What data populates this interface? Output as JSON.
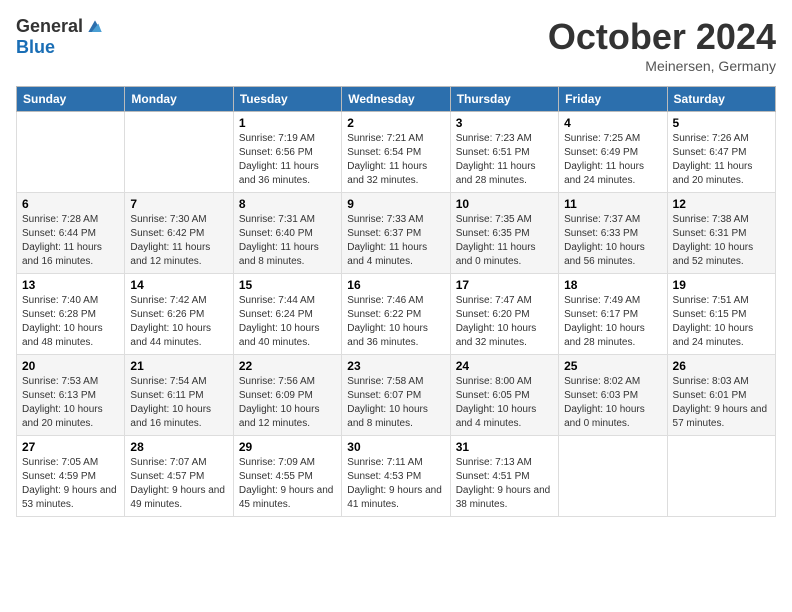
{
  "header": {
    "logo_general": "General",
    "logo_blue": "Blue",
    "month_title": "October 2024",
    "location": "Meinersen, Germany"
  },
  "days_of_week": [
    "Sunday",
    "Monday",
    "Tuesday",
    "Wednesday",
    "Thursday",
    "Friday",
    "Saturday"
  ],
  "weeks": [
    [
      {
        "day": "",
        "info": ""
      },
      {
        "day": "",
        "info": ""
      },
      {
        "day": "1",
        "info": "Sunrise: 7:19 AM\nSunset: 6:56 PM\nDaylight: 11 hours and 36 minutes."
      },
      {
        "day": "2",
        "info": "Sunrise: 7:21 AM\nSunset: 6:54 PM\nDaylight: 11 hours and 32 minutes."
      },
      {
        "day": "3",
        "info": "Sunrise: 7:23 AM\nSunset: 6:51 PM\nDaylight: 11 hours and 28 minutes."
      },
      {
        "day": "4",
        "info": "Sunrise: 7:25 AM\nSunset: 6:49 PM\nDaylight: 11 hours and 24 minutes."
      },
      {
        "day": "5",
        "info": "Sunrise: 7:26 AM\nSunset: 6:47 PM\nDaylight: 11 hours and 20 minutes."
      }
    ],
    [
      {
        "day": "6",
        "info": "Sunrise: 7:28 AM\nSunset: 6:44 PM\nDaylight: 11 hours and 16 minutes."
      },
      {
        "day": "7",
        "info": "Sunrise: 7:30 AM\nSunset: 6:42 PM\nDaylight: 11 hours and 12 minutes."
      },
      {
        "day": "8",
        "info": "Sunrise: 7:31 AM\nSunset: 6:40 PM\nDaylight: 11 hours and 8 minutes."
      },
      {
        "day": "9",
        "info": "Sunrise: 7:33 AM\nSunset: 6:37 PM\nDaylight: 11 hours and 4 minutes."
      },
      {
        "day": "10",
        "info": "Sunrise: 7:35 AM\nSunset: 6:35 PM\nDaylight: 11 hours and 0 minutes."
      },
      {
        "day": "11",
        "info": "Sunrise: 7:37 AM\nSunset: 6:33 PM\nDaylight: 10 hours and 56 minutes."
      },
      {
        "day": "12",
        "info": "Sunrise: 7:38 AM\nSunset: 6:31 PM\nDaylight: 10 hours and 52 minutes."
      }
    ],
    [
      {
        "day": "13",
        "info": "Sunrise: 7:40 AM\nSunset: 6:28 PM\nDaylight: 10 hours and 48 minutes."
      },
      {
        "day": "14",
        "info": "Sunrise: 7:42 AM\nSunset: 6:26 PM\nDaylight: 10 hours and 44 minutes."
      },
      {
        "day": "15",
        "info": "Sunrise: 7:44 AM\nSunset: 6:24 PM\nDaylight: 10 hours and 40 minutes."
      },
      {
        "day": "16",
        "info": "Sunrise: 7:46 AM\nSunset: 6:22 PM\nDaylight: 10 hours and 36 minutes."
      },
      {
        "day": "17",
        "info": "Sunrise: 7:47 AM\nSunset: 6:20 PM\nDaylight: 10 hours and 32 minutes."
      },
      {
        "day": "18",
        "info": "Sunrise: 7:49 AM\nSunset: 6:17 PM\nDaylight: 10 hours and 28 minutes."
      },
      {
        "day": "19",
        "info": "Sunrise: 7:51 AM\nSunset: 6:15 PM\nDaylight: 10 hours and 24 minutes."
      }
    ],
    [
      {
        "day": "20",
        "info": "Sunrise: 7:53 AM\nSunset: 6:13 PM\nDaylight: 10 hours and 20 minutes."
      },
      {
        "day": "21",
        "info": "Sunrise: 7:54 AM\nSunset: 6:11 PM\nDaylight: 10 hours and 16 minutes."
      },
      {
        "day": "22",
        "info": "Sunrise: 7:56 AM\nSunset: 6:09 PM\nDaylight: 10 hours and 12 minutes."
      },
      {
        "day": "23",
        "info": "Sunrise: 7:58 AM\nSunset: 6:07 PM\nDaylight: 10 hours and 8 minutes."
      },
      {
        "day": "24",
        "info": "Sunrise: 8:00 AM\nSunset: 6:05 PM\nDaylight: 10 hours and 4 minutes."
      },
      {
        "day": "25",
        "info": "Sunrise: 8:02 AM\nSunset: 6:03 PM\nDaylight: 10 hours and 0 minutes."
      },
      {
        "day": "26",
        "info": "Sunrise: 8:03 AM\nSunset: 6:01 PM\nDaylight: 9 hours and 57 minutes."
      }
    ],
    [
      {
        "day": "27",
        "info": "Sunrise: 7:05 AM\nSunset: 4:59 PM\nDaylight: 9 hours and 53 minutes."
      },
      {
        "day": "28",
        "info": "Sunrise: 7:07 AM\nSunset: 4:57 PM\nDaylight: 9 hours and 49 minutes."
      },
      {
        "day": "29",
        "info": "Sunrise: 7:09 AM\nSunset: 4:55 PM\nDaylight: 9 hours and 45 minutes."
      },
      {
        "day": "30",
        "info": "Sunrise: 7:11 AM\nSunset: 4:53 PM\nDaylight: 9 hours and 41 minutes."
      },
      {
        "day": "31",
        "info": "Sunrise: 7:13 AM\nSunset: 4:51 PM\nDaylight: 9 hours and 38 minutes."
      },
      {
        "day": "",
        "info": ""
      },
      {
        "day": "",
        "info": ""
      }
    ]
  ]
}
